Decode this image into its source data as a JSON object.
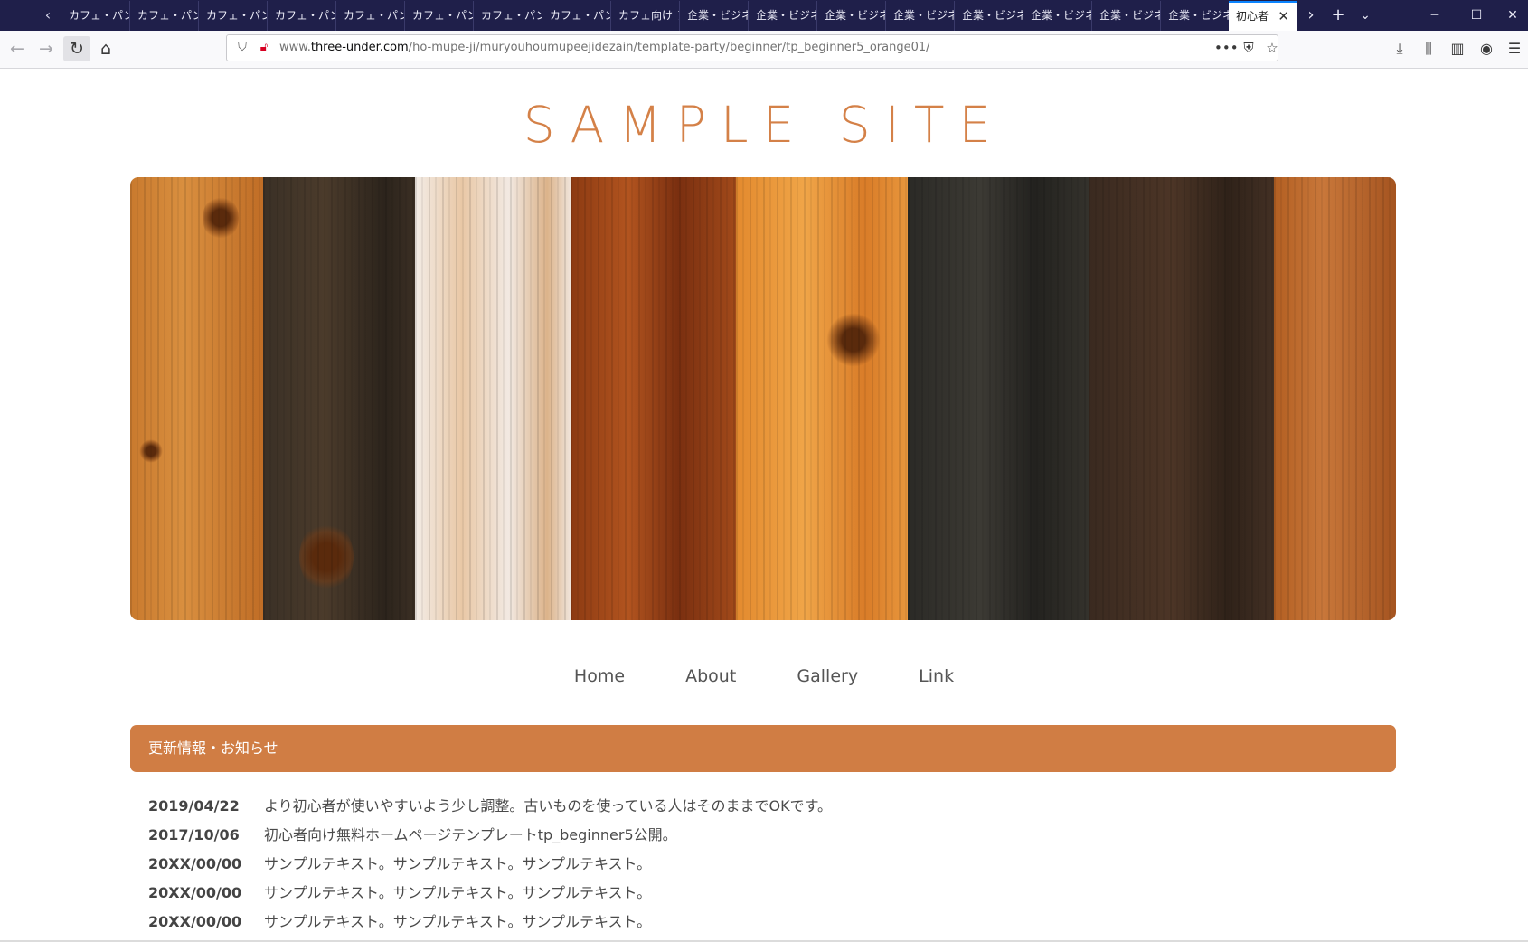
{
  "browser": {
    "tabs": [
      {
        "label": "カフェ・パン屋"
      },
      {
        "label": "カフェ・パン屋"
      },
      {
        "label": "カフェ・パン屋"
      },
      {
        "label": "カフェ・パン屋"
      },
      {
        "label": "カフェ・パン屋"
      },
      {
        "label": "カフェ・パン屋"
      },
      {
        "label": "カフェ・パン屋"
      },
      {
        "label": "カフェ・パン屋"
      },
      {
        "label": "カフェ向け テ"
      },
      {
        "label": "企業・ビジネ"
      },
      {
        "label": "企業・ビジネ"
      },
      {
        "label": "企業・ビジネ"
      },
      {
        "label": "企業・ビジネ"
      },
      {
        "label": "企業・ビジネ"
      },
      {
        "label": "企業・ビジネ"
      },
      {
        "label": "企業・ビジネ"
      },
      {
        "label": "企業・ビジネ"
      }
    ],
    "active_tab": {
      "label": "初心者"
    },
    "url": {
      "prefix": "www.",
      "domain": "three-under.com",
      "path": "/ho-mupe-ji/muryouhoumupeejidezain/template-party/beginner/tp_beginner5_orange01/"
    }
  },
  "site": {
    "title": "SAMPLE SITE",
    "menu": [
      "Home",
      "About",
      "Gallery",
      "Link"
    ],
    "news_heading": "更新情報・お知らせ",
    "news": [
      {
        "date": "2019/04/22",
        "text": "より初心者が使いやすいよう少し調整。古いものを使っている人はそのままでOKです。"
      },
      {
        "date": "2017/10/06",
        "text": "初心者向け無料ホームページテンプレートtp_beginner5公開。"
      },
      {
        "date": "20XX/00/00",
        "text": "サンプルテキスト。サンプルテキスト。サンプルテキスト。"
      },
      {
        "date": "20XX/00/00",
        "text": "サンプルテキスト。サンプルテキスト。サンプルテキスト。"
      },
      {
        "date": "20XX/00/00",
        "text": "サンプルテキスト。サンプルテキスト。サンプルテキスト。"
      }
    ]
  },
  "colors": {
    "accent": "#d07d44",
    "title": "#d48148",
    "tabbar": "#1f1f4a"
  }
}
